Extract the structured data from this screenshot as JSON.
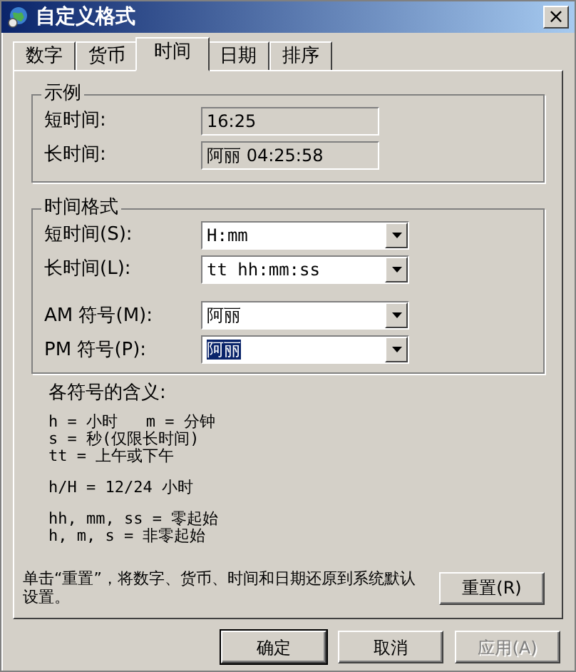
{
  "window": {
    "title": "自定义格式",
    "close": "×"
  },
  "tabs": [
    {
      "label": "数字",
      "selected": false
    },
    {
      "label": "货币",
      "selected": false
    },
    {
      "label": "时间",
      "selected": true
    },
    {
      "label": "日期",
      "selected": false
    },
    {
      "label": "排序",
      "selected": false
    }
  ],
  "example": {
    "title": "示例",
    "rows": [
      {
        "label": "短时间:",
        "value": "16:25"
      },
      {
        "label": "长时间:",
        "value": "阿丽 04:25:58"
      }
    ]
  },
  "time_format": {
    "title": "时间格式",
    "rows": [
      {
        "label": "短时间(S):",
        "value": "H:mm",
        "text_selected": false
      },
      {
        "label": "长时间(L):",
        "value": "tt hh:mm:ss",
        "text_selected": false
      },
      {
        "label": "AM 符号(M):",
        "value": "阿丽",
        "text_selected": false
      },
      {
        "label": "PM 符号(P):",
        "value": "阿丽",
        "text_selected": true
      }
    ]
  },
  "legend": {
    "title": "各符号的含义:",
    "groups": [
      [
        "h = 小时   m = 分钟",
        "s = 秒(仅限长时间)",
        "tt = 上午或下午"
      ],
      [
        "h/H = 12/24 小时"
      ],
      [
        "hh, mm, ss = 零起始",
        "h, m, s = 非零起始"
      ]
    ]
  },
  "reset": {
    "text": "单击“重置”，将数字、货币、时间和日期还原到系统默认设置。",
    "button": "重置(R)"
  },
  "buttons": [
    {
      "label": "确定",
      "disabled": false,
      "default": true
    },
    {
      "label": "取消",
      "disabled": false,
      "default": false
    },
    {
      "label": "应用(A)",
      "disabled": true,
      "default": false
    }
  ]
}
